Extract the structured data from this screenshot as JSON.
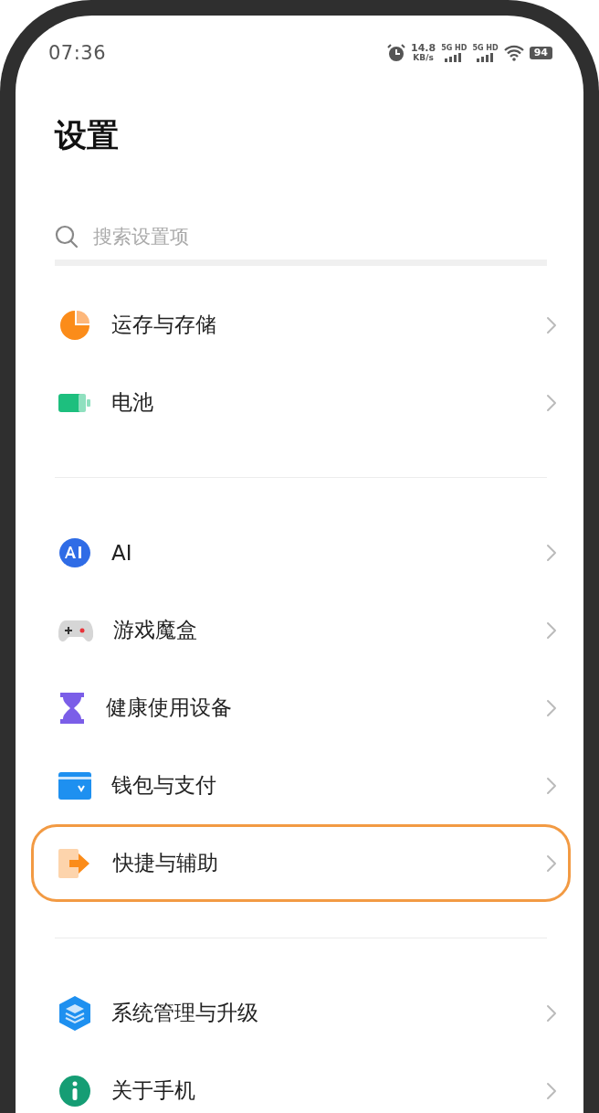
{
  "status_bar": {
    "time": "07:36",
    "speed": "14.8",
    "speed_unit": "KB/s",
    "sims": [
      "5G HD",
      "5G HD"
    ],
    "battery": "94"
  },
  "title": "设置",
  "search": {
    "placeholder": "搜索设置项"
  },
  "groups": [
    {
      "items": [
        {
          "label": "运存与存储",
          "highlighted": false
        },
        {
          "label": "电池",
          "highlighted": false
        }
      ]
    },
    {
      "items": [
        {
          "label": "AI",
          "highlighted": false
        },
        {
          "label": "游戏魔盒",
          "highlighted": false
        },
        {
          "label": "健康使用设备",
          "highlighted": false
        },
        {
          "label": "钱包与支付",
          "highlighted": false
        },
        {
          "label": "快捷与辅助",
          "highlighted": true
        }
      ]
    },
    {
      "items": [
        {
          "label": "系统管理与升级",
          "highlighted": false
        },
        {
          "label": "关于手机",
          "highlighted": false
        }
      ]
    }
  ]
}
